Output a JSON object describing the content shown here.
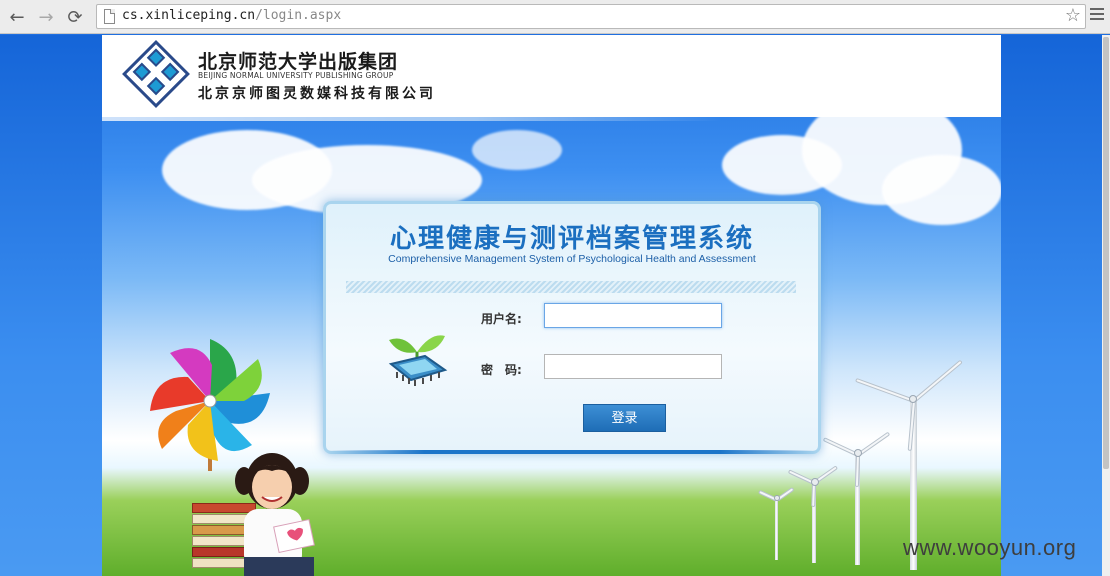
{
  "browser": {
    "url_host": "cs.xinliceping.cn",
    "url_path": "/login.aspx",
    "back_glyph": "←",
    "forward_glyph": "→",
    "reload_glyph": "⟳",
    "bookmark_glyph": "☆",
    "icons": [
      "back-arrow-icon",
      "forward-arrow-icon",
      "reload-icon",
      "page-icon",
      "star-icon",
      "menu-icon"
    ]
  },
  "header": {
    "org_name": "北京师范大学出版集团",
    "org_name_en": "BEIJING NORMAL UNIVERSITY PUBLISHING GROUP",
    "company": "北京京师图灵数媒科技有限公司"
  },
  "login": {
    "title": "心理健康与测评档案管理系统",
    "subtitle": "Comprehensive Management System of Psychological Health and Assessment",
    "username_label": "用户名:",
    "username_value": "",
    "password_label": "密　码:",
    "password_value": "",
    "submit_label": "登录"
  },
  "watermark": "www.wooyun.org",
  "colors": {
    "title_blue": "#1b6fc0",
    "button_blue": "#1e6db6",
    "sky_blue": "#1f6fe0"
  }
}
